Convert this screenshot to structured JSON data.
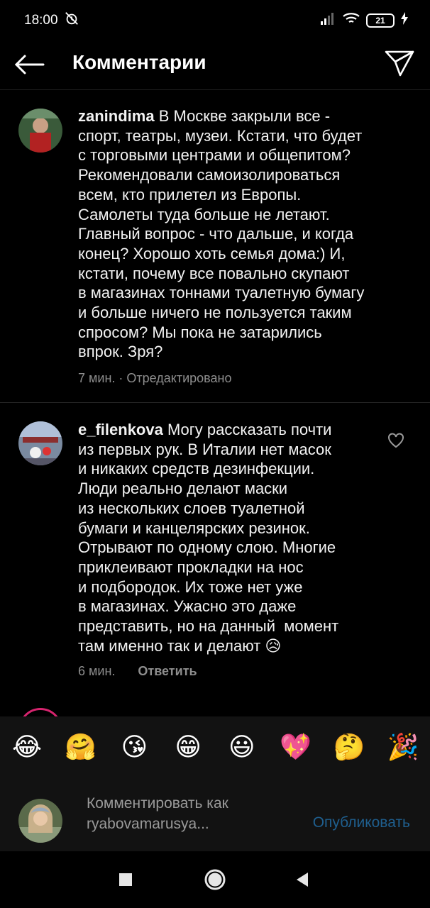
{
  "status_bar": {
    "time": "18:00",
    "battery": "21",
    "icons": [
      "alarm-off-icon",
      "signal-icon",
      "wifi-icon",
      "battery-icon",
      "charging-icon"
    ]
  },
  "header": {
    "title": "Комментарии",
    "back_icon": "arrow-left-icon",
    "send_icon": "paper-plane-icon"
  },
  "comments": [
    {
      "username": "zanindima",
      "text": "В Москве закрыли все -\nспорт, театры, музеи. Кстати, что будет\nс торговыми центрами и общепитом?\nРекомендовали самоизолироваться\nвсем, кто прилетел из Европы.\nСамолеты туда больше не летают.\nГлавный вопрос - что дальше, и когда\nконец? Хорошо хоть семья дома:) И,\nкстати, почему все повально скупают\nв магазинах тоннами туалетную бумагу\nи больше ничего не пользуется таким\nспросом? Мы пока не затарились\nвпрок. Зря?",
      "meta": "7 мин. · Отредактировано"
    },
    {
      "username": "e_filenkova",
      "text": "Могу рассказать почти\nиз первых рук. В Италии нет масок\nи никаких средств дезинфекции.\nЛюди реально делают маски\nиз нескольких слоев туалетной\nбумаги и канцелярских резинок.\nОтрывают по одному слою. Многие\nприклеивают прокладки на нос\nи подбородок. Их тоже нет уже\nв магазинах. Ужасно это даже\nпредставить, но на данный  момент\nтам именно так и делают 😥",
      "time": "6 мин.",
      "reply_label": "Ответить"
    }
  ],
  "emoji_bar": [
    "😂",
    "🤗",
    "😘",
    "😁",
    "😃",
    "💖",
    "🤔",
    "🎉"
  ],
  "composer": {
    "placeholder": "Комментировать как ryabovamarusya...",
    "publish_label": "Опубликовать"
  },
  "nav": [
    "recents-icon",
    "home-icon",
    "back-icon"
  ],
  "colors": {
    "background": "#000000",
    "text": "#f2f2f2",
    "meta": "#8e8e8e",
    "publish_disabled": "#1f5f8f"
  }
}
